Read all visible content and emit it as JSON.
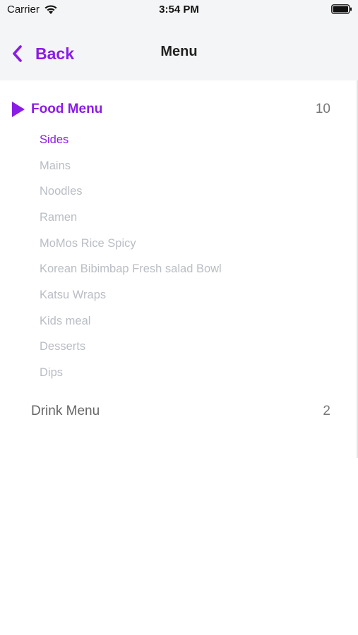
{
  "status_bar": {
    "carrier": "Carrier",
    "time": "3:54 PM"
  },
  "nav": {
    "back_label": "Back",
    "title": "Menu"
  },
  "accent_color": "#8a1ce8",
  "categories": [
    {
      "label": "Food Menu",
      "count": "10",
      "expanded": true,
      "items": [
        {
          "label": "Sides",
          "active": true
        },
        {
          "label": "Mains"
        },
        {
          "label": "Noodles"
        },
        {
          "label": "Ramen"
        },
        {
          "label": "MoMos Rice Spicy"
        },
        {
          "label": "Korean Bibimbap Fresh salad Bowl"
        },
        {
          "label": "Katsu Wraps"
        },
        {
          "label": "Kids meal"
        },
        {
          "label": "Desserts"
        },
        {
          "label": "Dips"
        }
      ]
    },
    {
      "label": "Drink Menu",
      "count": "2",
      "expanded": false
    }
  ]
}
